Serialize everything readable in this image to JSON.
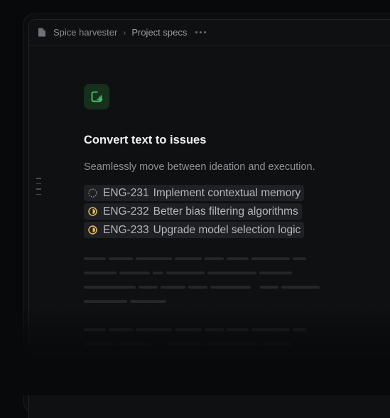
{
  "breadcrumb": {
    "workspace": "Spice harvester",
    "page": "Project specs"
  },
  "icons": {
    "breadcrumb_icon": "document-icon",
    "feature_icon": "square-plus-icon",
    "menu_icon": "more-horizontal-icon"
  },
  "colors": {
    "accent_green": "#4cc76a",
    "status_in_progress": "#e2b95a",
    "status_backlog": "#8a8d93"
  },
  "feature": {
    "title": "Convert text to issues",
    "description": "Seamlessly move between ideation and execution."
  },
  "issues": [
    {
      "id": "ENG-231",
      "title": "Implement contextual memory",
      "status": "backlog"
    },
    {
      "id": "ENG-232",
      "title": "Better bias filtering algorithms",
      "status": "in-progress"
    },
    {
      "id": "ENG-233",
      "title": "Upgrade model selection logic",
      "status": "in-progress"
    }
  ]
}
